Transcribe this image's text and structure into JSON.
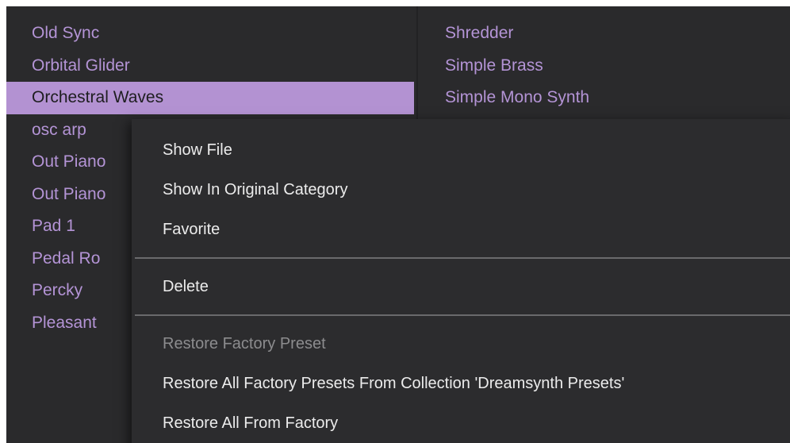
{
  "preset_list": {
    "left_column": [
      "Old Sync",
      "Orbital Glider",
      "Orchestral Waves",
      "osc arp",
      "Out Piano",
      "Out Piano",
      "Pad 1",
      "Pedal Ro",
      "Percky",
      "Pleasant"
    ],
    "selected_index": 2,
    "right_column": [
      "Shredder",
      "Simple Brass",
      "Simple Mono Synth"
    ]
  },
  "context_menu": {
    "show_file": "Show File",
    "show_in_original_category": "Show In Original Category",
    "favorite": "Favorite",
    "delete": "Delete",
    "restore_factory_preset": "Restore Factory Preset",
    "restore_all_from_collection": "Restore All Factory Presets From Collection 'Dreamsynth Presets'",
    "restore_all_from_factory": "Restore All From Factory"
  },
  "colors": {
    "panel_bg": "#2a2a2c",
    "preset_text": "#b494d6",
    "selection_bg": "#b392d2",
    "menu_text": "#ececec",
    "menu_disabled_text": "#8c8c8e"
  }
}
